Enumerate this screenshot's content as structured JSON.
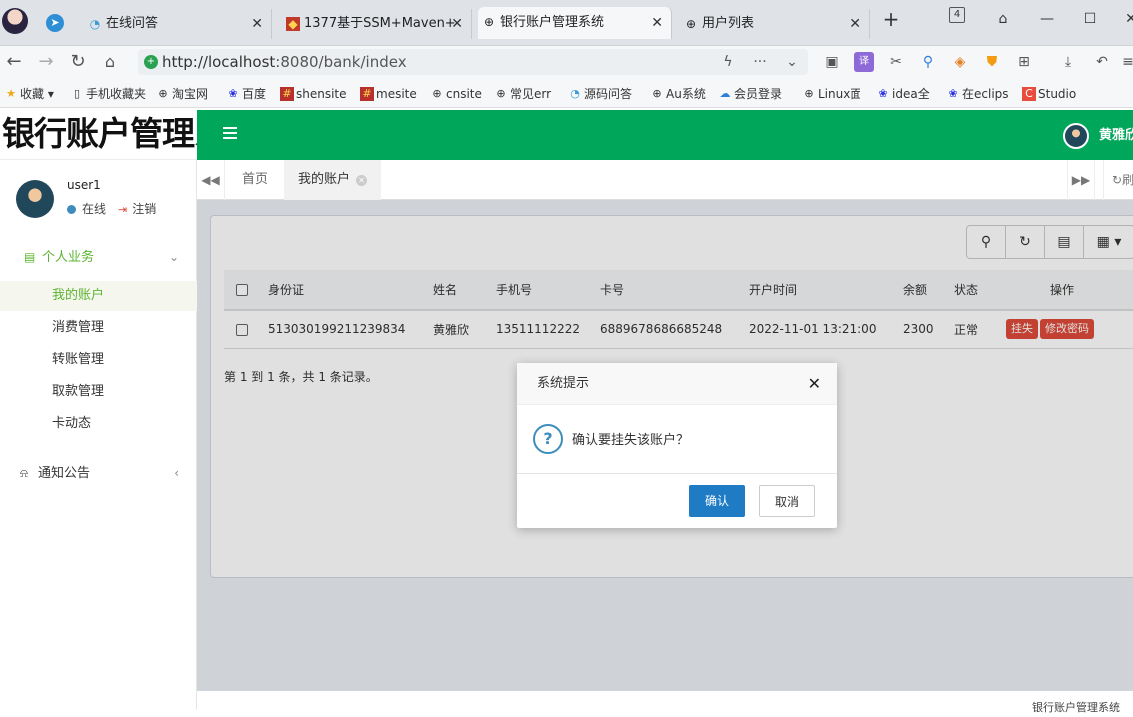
{
  "browser": {
    "tabs": [
      {
        "label": "在线问答"
      },
      {
        "label": "1377基于SSM+Maven+"
      },
      {
        "label": "银行账户管理系统"
      },
      {
        "label": "用户列表"
      }
    ],
    "tab_count_badge": "4",
    "url_host": "http://localhost",
    "url_path": ":8080/bank/index",
    "bookmarks": [
      "收藏",
      "手机收藏夹",
      "淘宝网",
      "百度",
      "shensite",
      "mesite",
      "cnsite",
      "常见err",
      "源码问答",
      "Au系统",
      "会员登录",
      "Linux面",
      "idea全",
      "在eclips",
      "Studio"
    ]
  },
  "app": {
    "logo_text": "银行账户管理系统",
    "top_user": "黄雅欣",
    "footer_text": "银行账户管理系统"
  },
  "sidebar": {
    "user": "user1",
    "online": "在线",
    "logout": "注销",
    "groups": [
      {
        "label": "个人业务",
        "items": [
          "我的账户",
          "消费管理",
          "转账管理",
          "取款管理",
          "卡动态"
        ]
      },
      {
        "label": "通知公告"
      }
    ]
  },
  "page_tabs": {
    "home": "首页",
    "current": "我的账户",
    "refresh": "刷新"
  },
  "table": {
    "columns": [
      "身份证",
      "姓名",
      "手机号",
      "卡号",
      "开户时间",
      "余额",
      "状态",
      "操作"
    ],
    "rows": [
      {
        "id_card": "513030199211239834",
        "name": "黄雅欣",
        "phone": "13511112222",
        "card": "6889678686685248",
        "open_time": "2022-11-01 13:21:00",
        "balance": "2300",
        "status": "正常",
        "action_lost": "挂失",
        "action_pwd": "修改密码"
      }
    ],
    "summary": "第 1 到 1 条，共 1 条记录。"
  },
  "dialog": {
    "title": "系统提示",
    "message": "确认要挂失该账户？",
    "ok": "确认",
    "cancel": "取消"
  },
  "colors": {
    "brand_green": "#00a65a",
    "danger": "#dd4b39",
    "primary": "#1e7bc4"
  }
}
